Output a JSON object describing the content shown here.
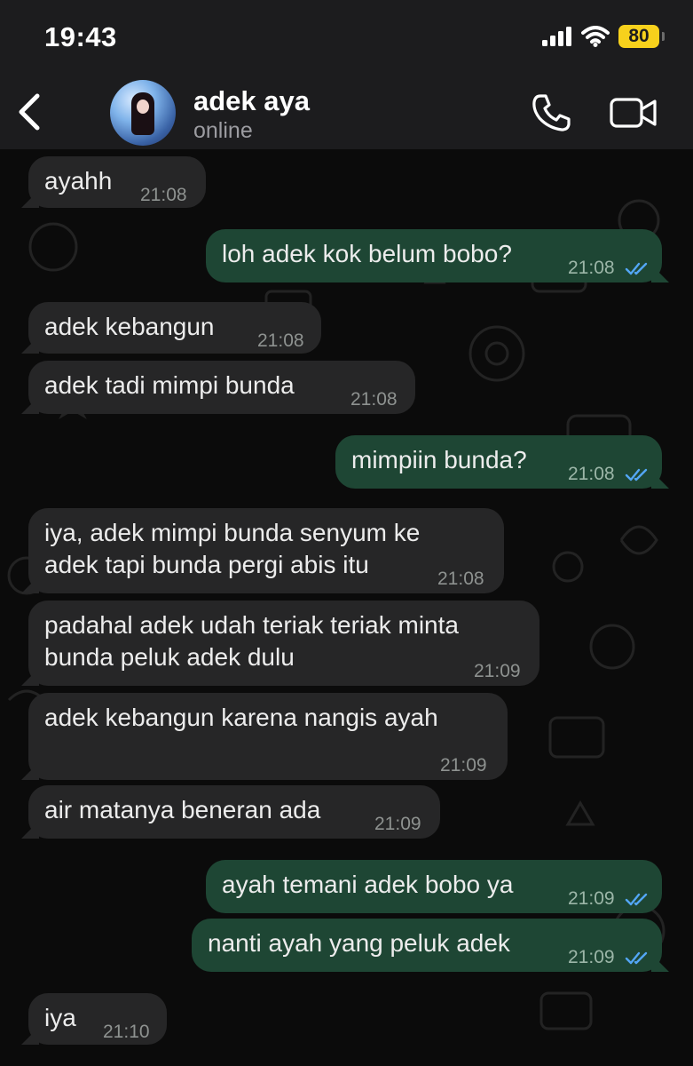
{
  "status_bar": {
    "time": "19:43",
    "battery": "80"
  },
  "header": {
    "name": "adek aya",
    "status": "online"
  },
  "messages": [
    {
      "dir": "in",
      "text": "ayahh",
      "time": "21:08"
    },
    {
      "dir": "out",
      "text": "loh adek kok belum bobo?",
      "time": "21:08",
      "read": true
    },
    {
      "dir": "in",
      "text": "adek kebangun",
      "time": "21:08"
    },
    {
      "dir": "in",
      "text": "adek tadi mimpi bunda",
      "time": "21:08"
    },
    {
      "dir": "out",
      "text": "mimpiin bunda?",
      "time": "21:08",
      "read": true
    },
    {
      "dir": "in",
      "line1": "iya, adek mimpi bunda senyum ke",
      "line2": "adek tapi bunda pergi abis itu",
      "time": "21:08"
    },
    {
      "dir": "in",
      "line1": "padahal adek udah teriak teriak minta",
      "line2": "bunda peluk adek dulu",
      "time": "21:09"
    },
    {
      "dir": "in",
      "text": "adek kebangun karena nangis ayah",
      "time": "21:09"
    },
    {
      "dir": "in",
      "text": "air matanya beneran ada",
      "time": "21:09"
    },
    {
      "dir": "out",
      "text": "ayah temani adek bobo ya",
      "time": "21:09",
      "read": true
    },
    {
      "dir": "out",
      "text": "nanti ayah yang peluk adek",
      "time": "21:09",
      "read": true
    },
    {
      "dir": "in",
      "text": "iya",
      "time": "21:10"
    }
  ],
  "colors": {
    "incoming": "#262627",
    "outgoing": "#1e4634",
    "read_tick": "#53a6f5",
    "battery": "#f7d11c"
  },
  "icons": [
    "back-chevron-icon",
    "phone-icon",
    "video-camera-icon",
    "signal-icon",
    "wifi-icon",
    "battery-icon",
    "double-check-icon"
  ]
}
